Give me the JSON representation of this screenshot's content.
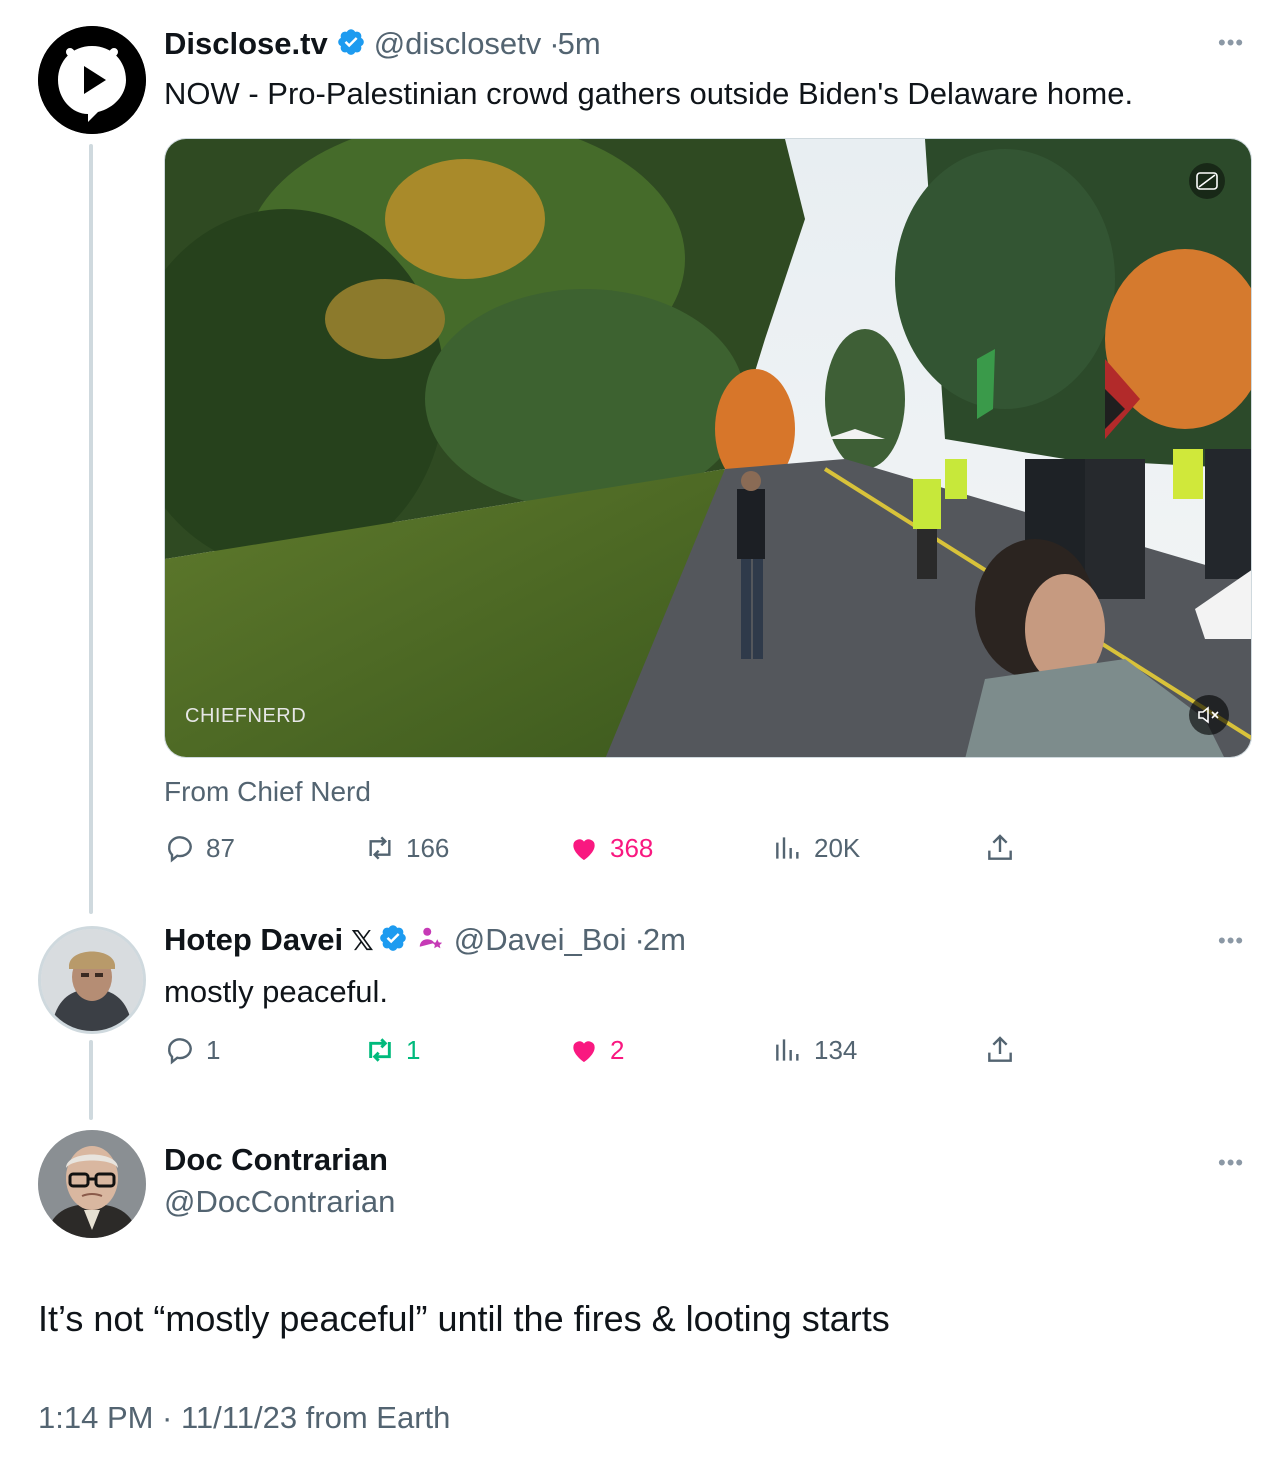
{
  "tweets": [
    {
      "name": "Disclose.tv",
      "handle": "@disclosetv",
      "time_sep": "·",
      "time": "5m",
      "text": "NOW - Pro-Palestinian crowd gathers outside Biden's Delaware home.",
      "media": {
        "watermark": "CHIEFNERD",
        "caption_icon": "closed-caption-icon",
        "mute_icon": "mute-icon"
      },
      "from": "From Chief Nerd",
      "stats": {
        "replies": "87",
        "reposts": "166",
        "likes": "368",
        "views": "20K"
      },
      "liked": true
    },
    {
      "name": "Hotep Davei",
      "handle": "@Davei_Boi",
      "time_sep": "·",
      "time": "2m",
      "text": "mostly peaceful.",
      "stats": {
        "replies": "1",
        "reposts": "1",
        "likes": "2",
        "views": "134"
      },
      "liked": true,
      "reposted": true
    },
    {
      "name": "Doc Contrarian",
      "handle": "@DocContrarian",
      "text": "It’s not “mostly peaceful” until the fires & looting starts",
      "timestamp": "1:14 PM · 11/11/23 from Earth"
    }
  ],
  "colors": {
    "verified": "#1d9bf0",
    "like": "#f91880",
    "repost": "#00ba7c",
    "secondary_text": "#536471",
    "thread_line": "#cfd9de"
  }
}
